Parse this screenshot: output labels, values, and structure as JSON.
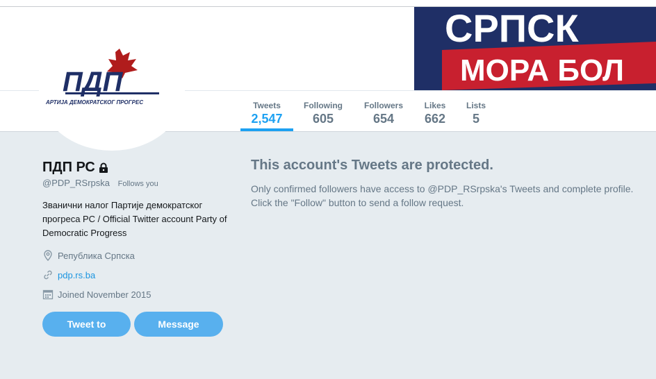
{
  "banner": {
    "line1": "СРПСК",
    "line2": "МОРА БОЛ",
    "colors": {
      "navy": "#1f2f66",
      "red": "#c8202f"
    }
  },
  "avatar": {
    "logo_text": "ПДП",
    "tagline": "АРТИЈА ДЕМОКРАТСКОГ ПРОГРЕС",
    "colors": {
      "navy": "#1f2f66",
      "leaf": "#b01c1c"
    }
  },
  "stats": [
    {
      "label": "Tweets",
      "value": "2,547",
      "active": true
    },
    {
      "label": "Following",
      "value": "605"
    },
    {
      "label": "Followers",
      "value": "654"
    },
    {
      "label": "Likes",
      "value": "662"
    },
    {
      "label": "Lists",
      "value": "5"
    }
  ],
  "profile": {
    "name": "ПДП РС",
    "lock_icon": "lock-icon",
    "handle": "@PDP_RSrpska",
    "follows_you": "Follows you",
    "bio": "Званични налог Партије демократског прогреса РС / Official Twitter account Party of Democratic Progress",
    "location": "Република Српска",
    "website": "pdp.rs.ba",
    "joined": "Joined November 2015"
  },
  "buttons": {
    "tweet_to": "Tweet to",
    "message": "Message"
  },
  "protected": {
    "title": "This account's Tweets are protected.",
    "body": "Only confirmed followers have access to @PDP_RSrpska's Tweets and complete profile. Click the \"Follow\" button to send a follow request."
  },
  "colors": {
    "accent": "#1da1f2",
    "button": "#58b0ee",
    "muted": "#657786",
    "page_bg": "#e6ecf0"
  }
}
